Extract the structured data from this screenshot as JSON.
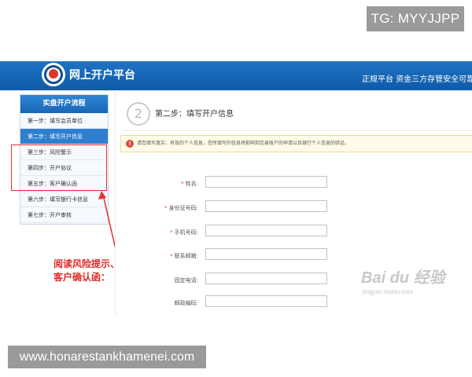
{
  "overlay": {
    "tg_badge": "TG: MYYJJPP",
    "site_badge": "www.honarestankhamenei.com"
  },
  "header": {
    "platform_name": "网上开户平台",
    "slogan": "正规平台 资金三方存管安全可靠"
  },
  "sidebar": {
    "title": "实盘开户流程",
    "steps": [
      {
        "label": "第一步：填写会员单位"
      },
      {
        "label": "第二步：填写开户信息"
      },
      {
        "label": "第三步：风险警示"
      },
      {
        "label": "第四步：开户协议"
      },
      {
        "label": "第五步：客户确认函"
      },
      {
        "label": "第六步：填写银行卡信息"
      },
      {
        "label": "第七步：开户审核"
      }
    ]
  },
  "annotation": {
    "line1": "阅读风险提示、开户协议、",
    "line2": "客户确认函："
  },
  "main": {
    "step_number": "2",
    "step_title": "第二步：填写开户信息",
    "notice_icon": "!",
    "notice": "请您填写真实、有效的个人信息，您所填写的信息将影响到交易账户的申请以及银行个人信息的验证。",
    "fields": [
      {
        "label": "姓名:",
        "required": "*",
        "value": "",
        "placeholder": ""
      },
      {
        "label": "身份证号码:",
        "required": "*",
        "value": "",
        "placeholder": ""
      },
      {
        "label": "手机号码:",
        "required": "*",
        "value": "",
        "placeholder": ""
      },
      {
        "label": "联系邮箱:",
        "required": "*",
        "value": "",
        "placeholder": ""
      },
      {
        "label": "固定电话:",
        "required": "",
        "value": "",
        "placeholder": ""
      },
      {
        "label": "邮政编码:",
        "required": "",
        "value": "",
        "placeholder": ""
      }
    ]
  },
  "watermark": {
    "logo": "Bai du 经验",
    "url": "jingyan.baidu.com"
  },
  "colors": {
    "header_blue": "#1766b4",
    "active_step": "#2e7fcf",
    "annotation_red": "#e02a2a"
  }
}
